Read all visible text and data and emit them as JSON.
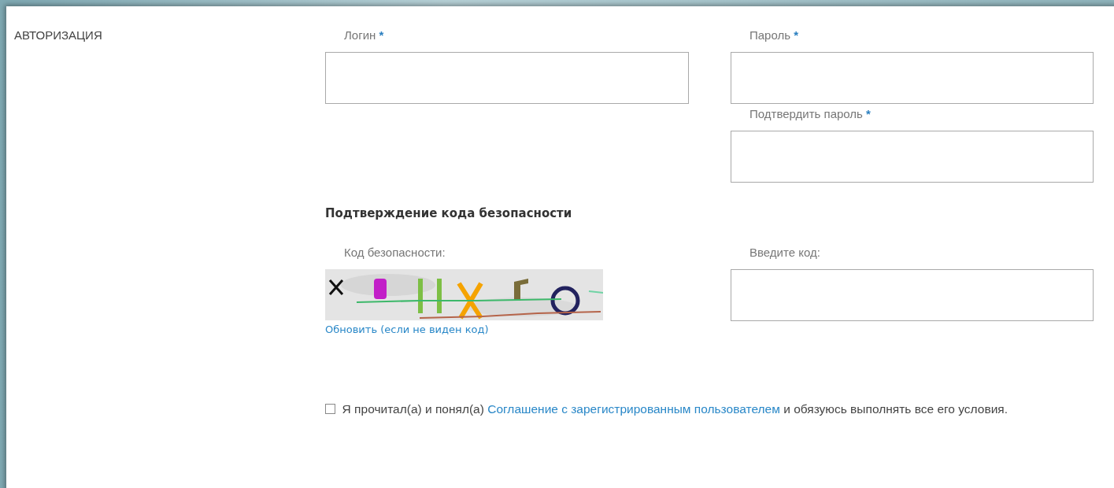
{
  "section_title": "АВТОРИЗАЦИЯ",
  "fields": [
    {
      "label": "Логин",
      "required_mark": "*"
    },
    {
      "label": "Пароль",
      "required_mark": "*"
    },
    {
      "label": "Подтвердить пароль",
      "required_mark": "*"
    }
  ],
  "security": {
    "heading": "Подтверждение кода безопасности",
    "captcha_label": "Код безопасности:",
    "refresh_link": "Обновить (если не виден код)",
    "code_field": {
      "label": "Введите код:"
    }
  },
  "agreement": {
    "checked": false,
    "text_before": "Я прочитал(а) и понял(а)",
    "link": "Соглашение с зарегистрированным пользователем",
    "text_after": "и обязуюсь выполнять все его условия."
  }
}
